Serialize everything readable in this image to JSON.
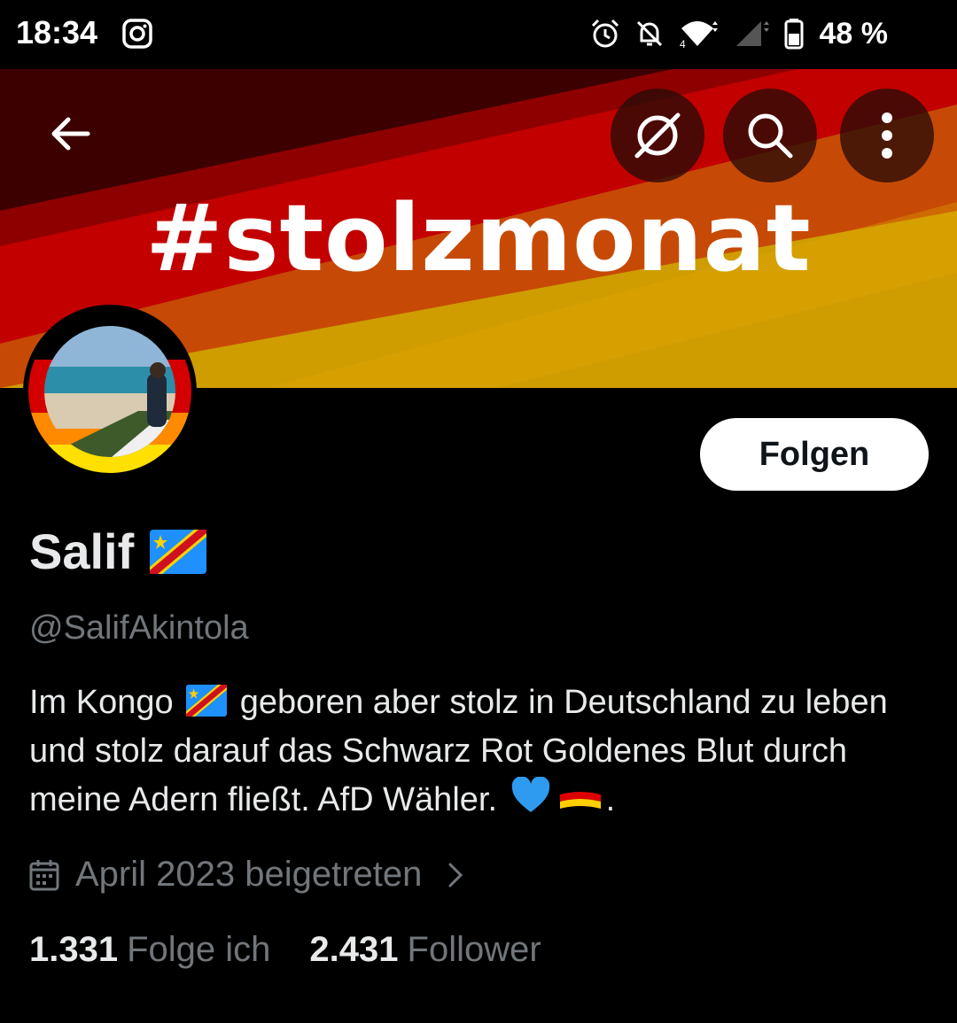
{
  "status_bar": {
    "time": "18:34",
    "battery": "48 %",
    "icons": [
      "instagram-icon",
      "alarm-icon",
      "bell-off-icon",
      "wifi-icon",
      "signal-icon",
      "battery-icon"
    ]
  },
  "header": {
    "banner_text": "#stolzmonat",
    "back_icon": "arrow-left-icon",
    "grok_icon": "grok-icon",
    "search_icon": "search-icon",
    "more_icon": "more-vertical-icon"
  },
  "profile": {
    "follow_label": "Folgen",
    "display_name": "Salif",
    "name_flag": "congo-flag-icon",
    "handle": "@SalifAkintola",
    "bio_part1": "Im Kongo",
    "bio_part2": "geboren aber stolz in Deutschland  zu leben und stolz darauf das Schwarz Rot Goldenes Blut durch meine Adern fließt. AfD Wähler.",
    "bio_end": ".",
    "joined": "April 2023 beigetreten",
    "following_count": "1.331",
    "following_label": "Folge ich",
    "followers_count": "2.431",
    "followers_label": "Follower"
  },
  "colors": {
    "background": "#000000",
    "text_primary": "#e7e9ea",
    "text_secondary": "#71767b",
    "follow_button_bg": "#ffffff",
    "flag_black": "#000000",
    "flag_red": "#dd0000",
    "flag_gold": "#ffce00"
  }
}
